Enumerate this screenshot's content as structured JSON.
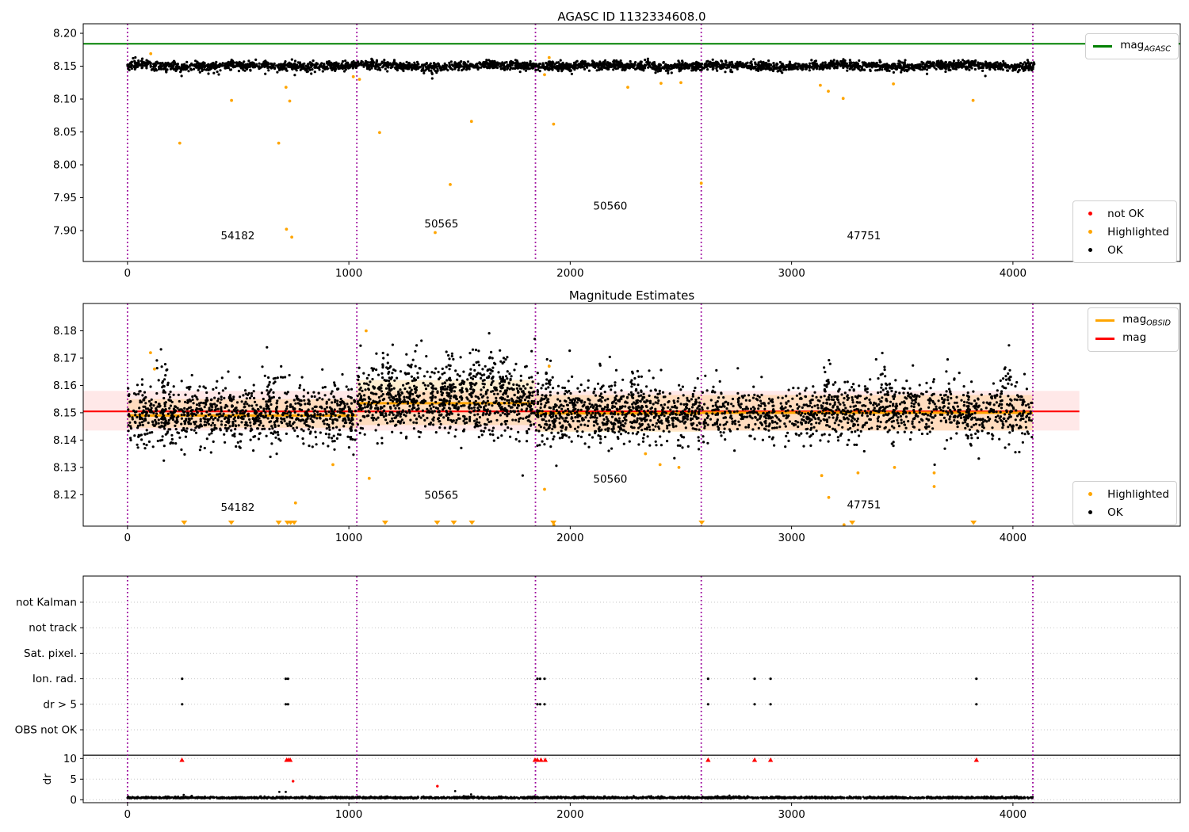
{
  "colors": {
    "ok": "#000000",
    "highlighted": "#FFA500",
    "not_ok": "#FF0000",
    "mag_agasc": "#008000",
    "mag": "#FF0000",
    "mag_obsid": "#FFA500",
    "boundary": "#990099",
    "band_pink": "rgba(255,0,0,0.09)",
    "band_orange": "rgba(255,165,0,0.18)",
    "grid": "#c9c9c9"
  },
  "chart_data": [
    {
      "type": "scatter",
      "title": "AGASC ID 1132334608.0",
      "xlim": [
        -200,
        4756
      ],
      "ylim": [
        7.853,
        8.2145
      ],
      "xticks": [
        0,
        1000,
        2000,
        3000,
        4000
      ],
      "yticks": [
        7.9,
        7.95,
        8.0,
        8.05,
        8.1,
        8.15,
        8.2
      ],
      "mag_agasc_line": {
        "value": 8.184,
        "color": "#008000"
      },
      "vlines": {
        "x": [
          0,
          1036,
          1843,
          2592,
          4090
        ],
        "color": "#990099"
      },
      "obsid_labels": [
        {
          "text": "54182",
          "x": 498,
          "y": 7.887
        },
        {
          "text": "50565",
          "x": 1418,
          "y": 7.905
        },
        {
          "text": "50560",
          "x": 2181,
          "y": 7.932
        },
        {
          "text": "47751",
          "x": 3327,
          "y": 7.887
        }
      ],
      "ok_series": {
        "x_range": [
          0,
          4097
        ],
        "n": 3200,
        "mean": 8.1505,
        "std": 0.0033,
        "wiggle_amp": 0.0014,
        "low_tail_frac": 0.02
      },
      "highlighted_points": [
        [
          105,
          8.169
        ],
        [
          236,
          8.033
        ],
        [
          470,
          8.098
        ],
        [
          683,
          8.033
        ],
        [
          716,
          8.118
        ],
        [
          733,
          8.097
        ],
        [
          718,
          7.902
        ],
        [
          742,
          7.89
        ],
        [
          1020,
          8.134
        ],
        [
          1048,
          8.13
        ],
        [
          1139,
          8.049
        ],
        [
          1390,
          7.897
        ],
        [
          1458,
          7.97
        ],
        [
          1554,
          8.066
        ],
        [
          1884,
          8.137
        ],
        [
          1905,
          8.163
        ],
        [
          1925,
          8.062
        ],
        [
          2260,
          8.118
        ],
        [
          2410,
          8.124
        ],
        [
          2500,
          8.125
        ],
        [
          2592,
          7.972
        ],
        [
          3130,
          8.121
        ],
        [
          3166,
          8.112
        ],
        [
          3233,
          8.101
        ],
        [
          3460,
          8.123
        ],
        [
          3820,
          8.098
        ]
      ],
      "not_ok_points": [],
      "legend_top": {
        "items": [
          {
            "main": "mag",
            "sub": "AGASC",
            "marker": "line",
            "color": "#008000"
          }
        ]
      },
      "legend_bottom": {
        "items": [
          {
            "label": "not OK",
            "color": "#FF0000"
          },
          {
            "label": "Highlighted",
            "color": "#FFA500"
          },
          {
            "label": "OK",
            "color": "#000000"
          }
        ]
      }
    },
    {
      "type": "scatter",
      "title": "Magnitude Estimates",
      "xlim": [
        -200,
        4756
      ],
      "ylim": [
        8.1085,
        8.19
      ],
      "xticks": [
        0,
        1000,
        2000,
        3000,
        4000
      ],
      "yticks": [
        8.12,
        8.13,
        8.14,
        8.15,
        8.16,
        8.17,
        8.18
      ],
      "mag_line": {
        "value": 8.1505,
        "color": "#FF0000",
        "x_range": [
          -200,
          4300
        ]
      },
      "mag_band": {
        "lo": 8.1435,
        "hi": 8.158,
        "color": "rgba(255,0,0,0.09)",
        "x_range": [
          -200,
          4300
        ]
      },
      "obsid_line_color": "#FFA500",
      "obsid_band_color": "rgba(255,165,0,0.18)",
      "obsid_segments": [
        {
          "obsid": "54182",
          "x0": 0,
          "x1": 1036,
          "mag": 8.149,
          "band_lo": 8.1445,
          "band_hi": 8.155
        },
        {
          "obsid": "50565",
          "x0": 1036,
          "x1": 1843,
          "mag": 8.1535,
          "band_lo": 8.1455,
          "band_hi": 8.162
        },
        {
          "obsid": "50560",
          "x0": 1843,
          "x1": 2592,
          "mag": 8.1498,
          "band_lo": 8.143,
          "band_hi": 8.1565
        },
        {
          "obsid": "47751",
          "x0": 2592,
          "x1": 4090,
          "mag": 8.15,
          "band_lo": 8.1435,
          "band_hi": 8.1565
        }
      ],
      "vlines": {
        "x": [
          0,
          1036,
          1843,
          2592,
          4090
        ],
        "color": "#990099"
      },
      "obsid_labels": [
        {
          "text": "54182",
          "x": 498,
          "y": 8.114
        },
        {
          "text": "50565",
          "x": 1418,
          "y": 8.1185
        },
        {
          "text": "50560",
          "x": 2181,
          "y": 8.1245
        },
        {
          "text": "47751",
          "x": 3327,
          "y": 8.115
        }
      ],
      "ok_series": [
        {
          "x0": 0,
          "x1": 1036,
          "n": 1000,
          "mean": 8.1492,
          "std": 0.005,
          "spike_x": [
            170,
            640
          ]
        },
        {
          "x0": 1036,
          "x1": 1843,
          "n": 900,
          "mean": 8.1535,
          "std": 0.0058,
          "spike_x": [
            1180,
            1290,
            1450,
            1570,
            1640,
            1700
          ]
        },
        {
          "x0": 1843,
          "x1": 2592,
          "n": 780,
          "mean": 8.1498,
          "std": 0.0048,
          "spike_x": [
            1900,
            2290
          ]
        },
        {
          "x0": 2592,
          "x1": 4090,
          "n": 1150,
          "mean": 8.1502,
          "std": 0.0048,
          "spike_x": [
            3180,
            3420,
            3980
          ]
        }
      ],
      "highlighted_points": [
        [
          104,
          8.172
        ],
        [
          122,
          8.166
        ],
        [
          759,
          8.117
        ],
        [
          928,
          8.131
        ],
        [
          1078,
          8.18
        ],
        [
          1092,
          8.126
        ],
        [
          1884,
          8.122
        ],
        [
          1905,
          8.167
        ],
        [
          1926,
          8.109
        ],
        [
          2340,
          8.135
        ],
        [
          2406,
          8.131
        ],
        [
          2491,
          8.13
        ],
        [
          3136,
          8.127
        ],
        [
          3168,
          8.119
        ],
        [
          3237,
          8.109
        ],
        [
          3300,
          8.128
        ],
        [
          3465,
          8.13
        ],
        [
          3644,
          8.128
        ],
        [
          3644,
          8.123
        ]
      ],
      "clipped_low_x": [
        256,
        469,
        683,
        723,
        737,
        753,
        1164,
        1399,
        1474,
        1556,
        1924,
        2594,
        3274,
        3822
      ],
      "legend_top": {
        "items": [
          {
            "main": "mag",
            "sub": "OBSID",
            "marker": "line",
            "color": "#FFA500"
          },
          {
            "main": "mag",
            "sub": "",
            "marker": "line",
            "color": "#FF0000"
          }
        ]
      },
      "legend_bottom": {
        "items": [
          {
            "label": "Highlighted",
            "color": "#FFA500"
          },
          {
            "label": "OK",
            "color": "#000000"
          }
        ]
      }
    },
    {
      "type": "flags-and-dr",
      "flag_categories": [
        "not Kalman",
        "not track",
        "Sat. pixel.",
        "Ion. rad.",
        "dr > 5",
        "OBS not OK"
      ],
      "dr_ylabel": "dr",
      "dr_yticks": [
        0,
        5,
        10
      ],
      "xticks": [
        0,
        1000,
        2000,
        3000,
        4000
      ],
      "xlim": [
        -200,
        4756
      ],
      "separator_dr": 10.8,
      "vlines": {
        "x": [
          0,
          1036,
          1843,
          2592,
          4090
        ],
        "color": "#990099"
      },
      "flag_points": {
        "Ion. rad.": [
          247,
          715,
          725,
          1852,
          1864,
          1884,
          2623,
          2833,
          2905,
          3835
        ],
        "dr > 5": [
          247,
          715,
          725,
          1852,
          1864,
          1884,
          2623,
          2833,
          2905,
          3835
        ]
      },
      "dr_ok_series": {
        "x_range": [
          0,
          4090
        ],
        "n": 2600,
        "base": 0.3,
        "spread": 0.16
      },
      "dr_ok_outliers": [
        [
          254,
          1.2
        ],
        [
          686,
          1.9
        ],
        [
          715,
          1.9
        ],
        [
          1480,
          2.1
        ],
        [
          1552,
          1.3
        ]
      ],
      "dr_not_ok_points": [
        [
          246,
          9.8
        ],
        [
          719,
          9.8
        ],
        [
          727,
          9.8
        ],
        [
          735,
          9.8
        ],
        [
          748,
          4.5
        ],
        [
          1400,
          3.3
        ],
        [
          1841,
          9.6
        ],
        [
          1852,
          9.8
        ],
        [
          1868,
          9.8
        ],
        [
          1887,
          9.8
        ],
        [
          2623,
          9.8
        ],
        [
          2833,
          9.8
        ],
        [
          2905,
          9.8
        ],
        [
          3835,
          9.8
        ]
      ],
      "grid_color": "#c9c9c9"
    }
  ]
}
